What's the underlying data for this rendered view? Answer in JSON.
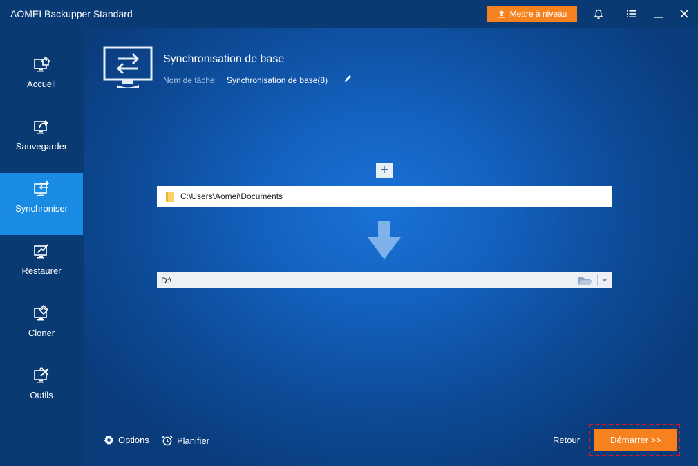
{
  "app": {
    "title": "AOMEI Backupper Standard"
  },
  "titlebar": {
    "upgrade_label": "Mettre à niveau"
  },
  "sidebar": {
    "items": [
      {
        "label": "Accueil",
        "icon": "home-monitor-icon"
      },
      {
        "label": "Sauvegarder",
        "icon": "backup-monitor-icon"
      },
      {
        "label": "Synchroniser",
        "icon": "sync-monitor-icon",
        "active": true
      },
      {
        "label": "Restaurer",
        "icon": "restore-monitor-icon"
      },
      {
        "label": "Cloner",
        "icon": "clone-monitor-icon"
      },
      {
        "label": "Outils",
        "icon": "tools-monitor-icon"
      }
    ]
  },
  "task": {
    "title": "Synchronisation de base",
    "name_label": "Nom de tâche:",
    "name_value": "Synchronisation de base(8)"
  },
  "source": {
    "add_label": "+",
    "path": "C:\\Users\\Aomei\\Documents"
  },
  "destination": {
    "value": "D:\\"
  },
  "footer": {
    "options_label": "Options",
    "schedule_label": "Planifier",
    "back_label": "Retour",
    "start_label": "Démarrer >>"
  },
  "colors": {
    "accent": "#1a8be3",
    "orange": "#f5821f",
    "highlight": "#e0141e"
  }
}
